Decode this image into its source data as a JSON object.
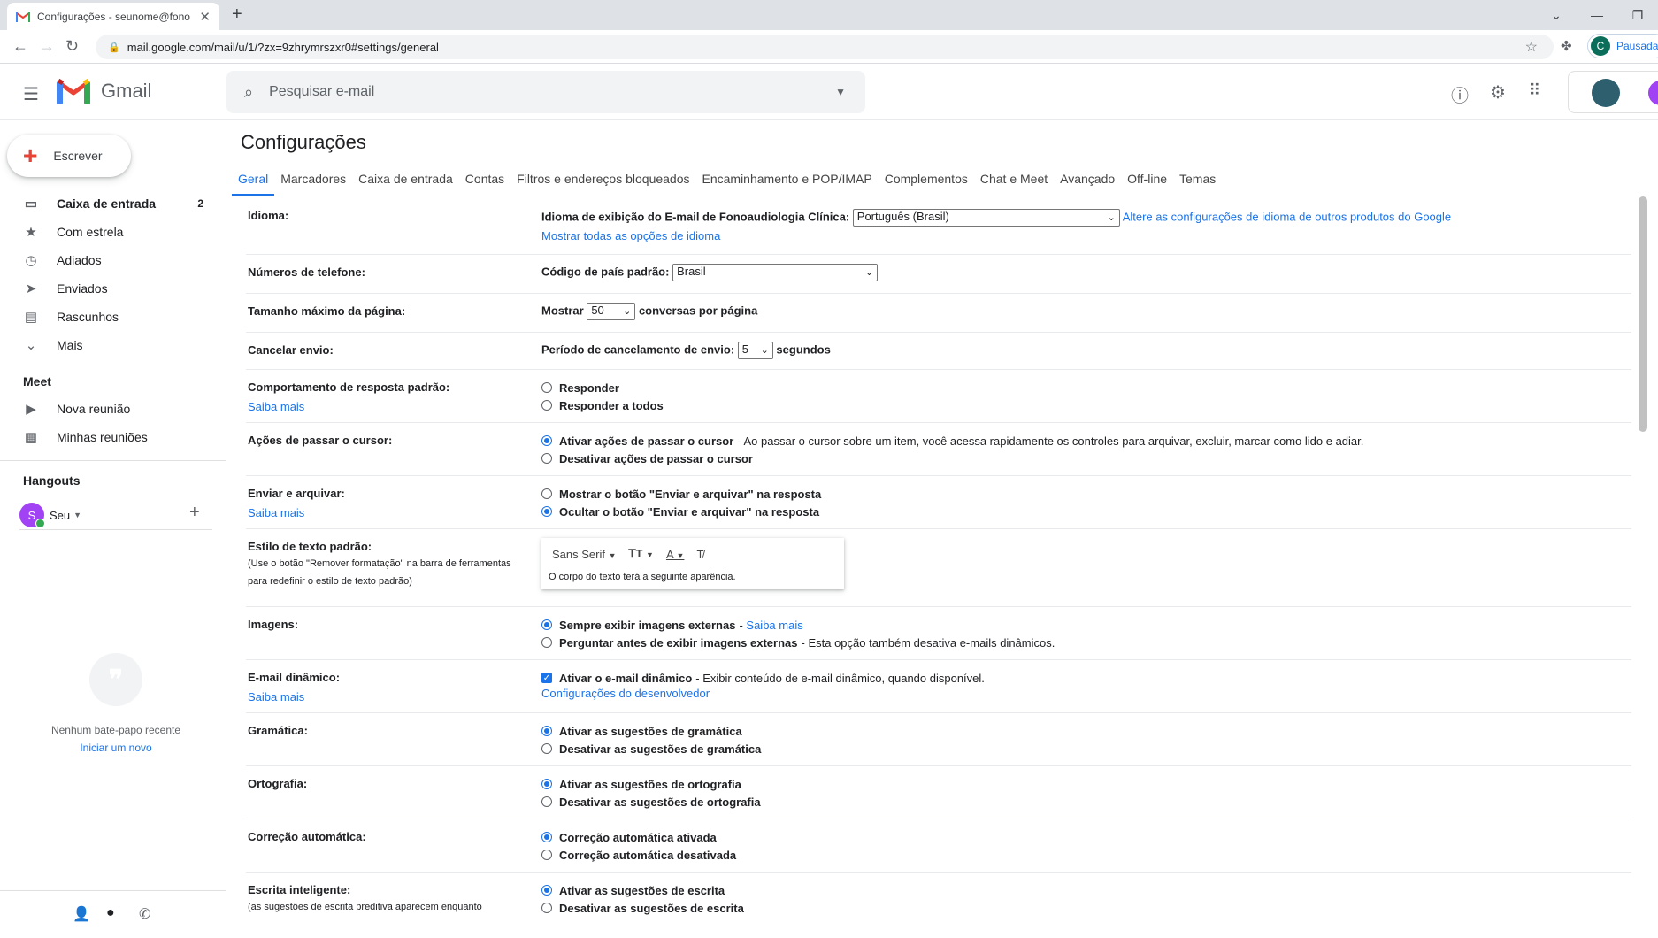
{
  "browser": {
    "tab_title": "Configurações - seunome@fono",
    "new_tab": "+",
    "url": "mail.google.com/mail/u/1/?zx=9zhrymrszxr0#settings/general",
    "profile_initial": "C",
    "profile_status": "Pausada"
  },
  "header": {
    "app_name": "Gmail",
    "search_placeholder": "Pesquisar e-mail"
  },
  "sidebar": {
    "compose_label": "Escrever",
    "items": [
      {
        "label": "Caixa de entrada",
        "count": "2",
        "icon": "inbox-icon"
      },
      {
        "label": "Com estrela",
        "icon": "star-icon"
      },
      {
        "label": "Adiados",
        "icon": "clock-icon"
      },
      {
        "label": "Enviados",
        "icon": "send-icon"
      },
      {
        "label": "Rascunhos",
        "icon": "draft-icon"
      },
      {
        "label": "Mais",
        "icon": "chevron-down-icon"
      }
    ],
    "meet_title": "Meet",
    "meet_items": [
      {
        "label": "Nova reunião",
        "icon": "video-icon"
      },
      {
        "label": "Minhas reuniões",
        "icon": "calendar-icon"
      }
    ],
    "hangouts_title": "Hangouts",
    "hangouts_user_initial": "S",
    "hangouts_user": "Seu",
    "no_chat": "Nenhum bate-papo recente",
    "start_new": "Iniciar um novo"
  },
  "settings": {
    "title": "Configurações",
    "tabs": [
      "Geral",
      "Marcadores",
      "Caixa de entrada",
      "Contas",
      "Filtros e endereços bloqueados",
      "Encaminhamento e POP/IMAP",
      "Complementos",
      "Chat e Meet",
      "Avançado",
      "Off-line",
      "Temas"
    ],
    "language": {
      "label": "Idioma:",
      "field_label": "Idioma de exibição do E-mail de Fonoaudiologia Clínica:",
      "value": "Português (Brasil)",
      "link1": "Altere as configurações de idioma de outros produtos do Google",
      "link2": "Mostrar todas as opções de idioma"
    },
    "phone": {
      "label": "Números de telefone:",
      "field_label": "Código de país padrão:",
      "value": "Brasil"
    },
    "page_size": {
      "label": "Tamanho máximo da página:",
      "prefix": "Mostrar",
      "value": "50",
      "suffix": "conversas por página"
    },
    "undo_send": {
      "label": "Cancelar envio:",
      "prefix": "Período de cancelamento de envio:",
      "value": "5",
      "suffix": "segundos"
    },
    "reply": {
      "label": "Comportamento de resposta padrão:",
      "learn_more": "Saiba mais",
      "opt1": "Responder",
      "opt2": "Responder a todos"
    },
    "hover": {
      "label": "Ações de passar o cursor:",
      "opt1": "Ativar ações de passar o cursor",
      "opt1_desc": "- Ao passar o cursor sobre um item, você acessa rapidamente os controles para arquivar, excluir, marcar como lido e adiar.",
      "opt2": "Desativar ações de passar o cursor"
    },
    "send_archive": {
      "label": "Enviar e arquivar:",
      "learn_more": "Saiba mais",
      "opt1": "Mostrar o botão \"Enviar e arquivar\" na resposta",
      "opt2": "Ocultar o botão \"Enviar e arquivar\" na resposta"
    },
    "text_style": {
      "label": "Estilo de texto padrão:",
      "sub": "(Use o botão \"Remover formatação\" na barra de ferramentas para redefinir o estilo de texto padrão)",
      "font": "Sans Serif",
      "sample": "O corpo do texto terá a seguinte aparência."
    },
    "images": {
      "label": "Imagens:",
      "opt1": "Sempre exibir imagens externas",
      "opt1_link": "Saiba mais",
      "opt2": "Perguntar antes de exibir imagens externas",
      "opt2_desc": "- Esta opção também desativa e-mails dinâmicos."
    },
    "dynamic": {
      "label": "E-mail dinâmico:",
      "learn_more": "Saiba mais",
      "opt1": "Ativar o e-mail dinâmico",
      "opt1_desc": "- Exibir conteúdo de e-mail dinâmico, quando disponível.",
      "dev_link": "Configurações do desenvolvedor"
    },
    "grammar": {
      "label": "Gramática:",
      "opt1": "Ativar as sugestões de gramática",
      "opt2": "Desativar as sugestões de gramática"
    },
    "spelling": {
      "label": "Ortografia:",
      "opt1": "Ativar as sugestões de ortografia",
      "opt2": "Desativar as sugestões de ortografia"
    },
    "autocorrect": {
      "label": "Correção automática:",
      "opt1": "Correção automática ativada",
      "opt2": "Correção automática desativada"
    },
    "smart_compose": {
      "label": "Escrita inteligente:",
      "sub": "(as sugestões de escrita preditiva aparecem enquanto",
      "opt1": "Ativar as sugestões de escrita",
      "opt2": "Desativar as sugestões de escrita"
    }
  }
}
